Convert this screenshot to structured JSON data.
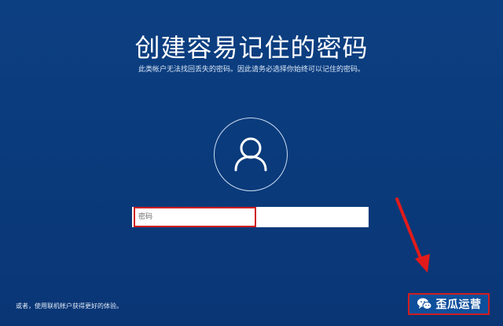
{
  "setup": {
    "title": "创建容易记住的密码",
    "subtitle": "此类帐户无法找回丢失的密码。因此请务必选择你始终可以记住的密码。",
    "password_placeholder": "密码",
    "footer_text": "或者，使用联机帐户获得更好的体验。"
  },
  "watermark": {
    "brand_text": "歪瓜运营",
    "brand_icon": "wechat-icon"
  },
  "colors": {
    "background": "#0a3a7a",
    "highlight": "#d01e1e"
  }
}
